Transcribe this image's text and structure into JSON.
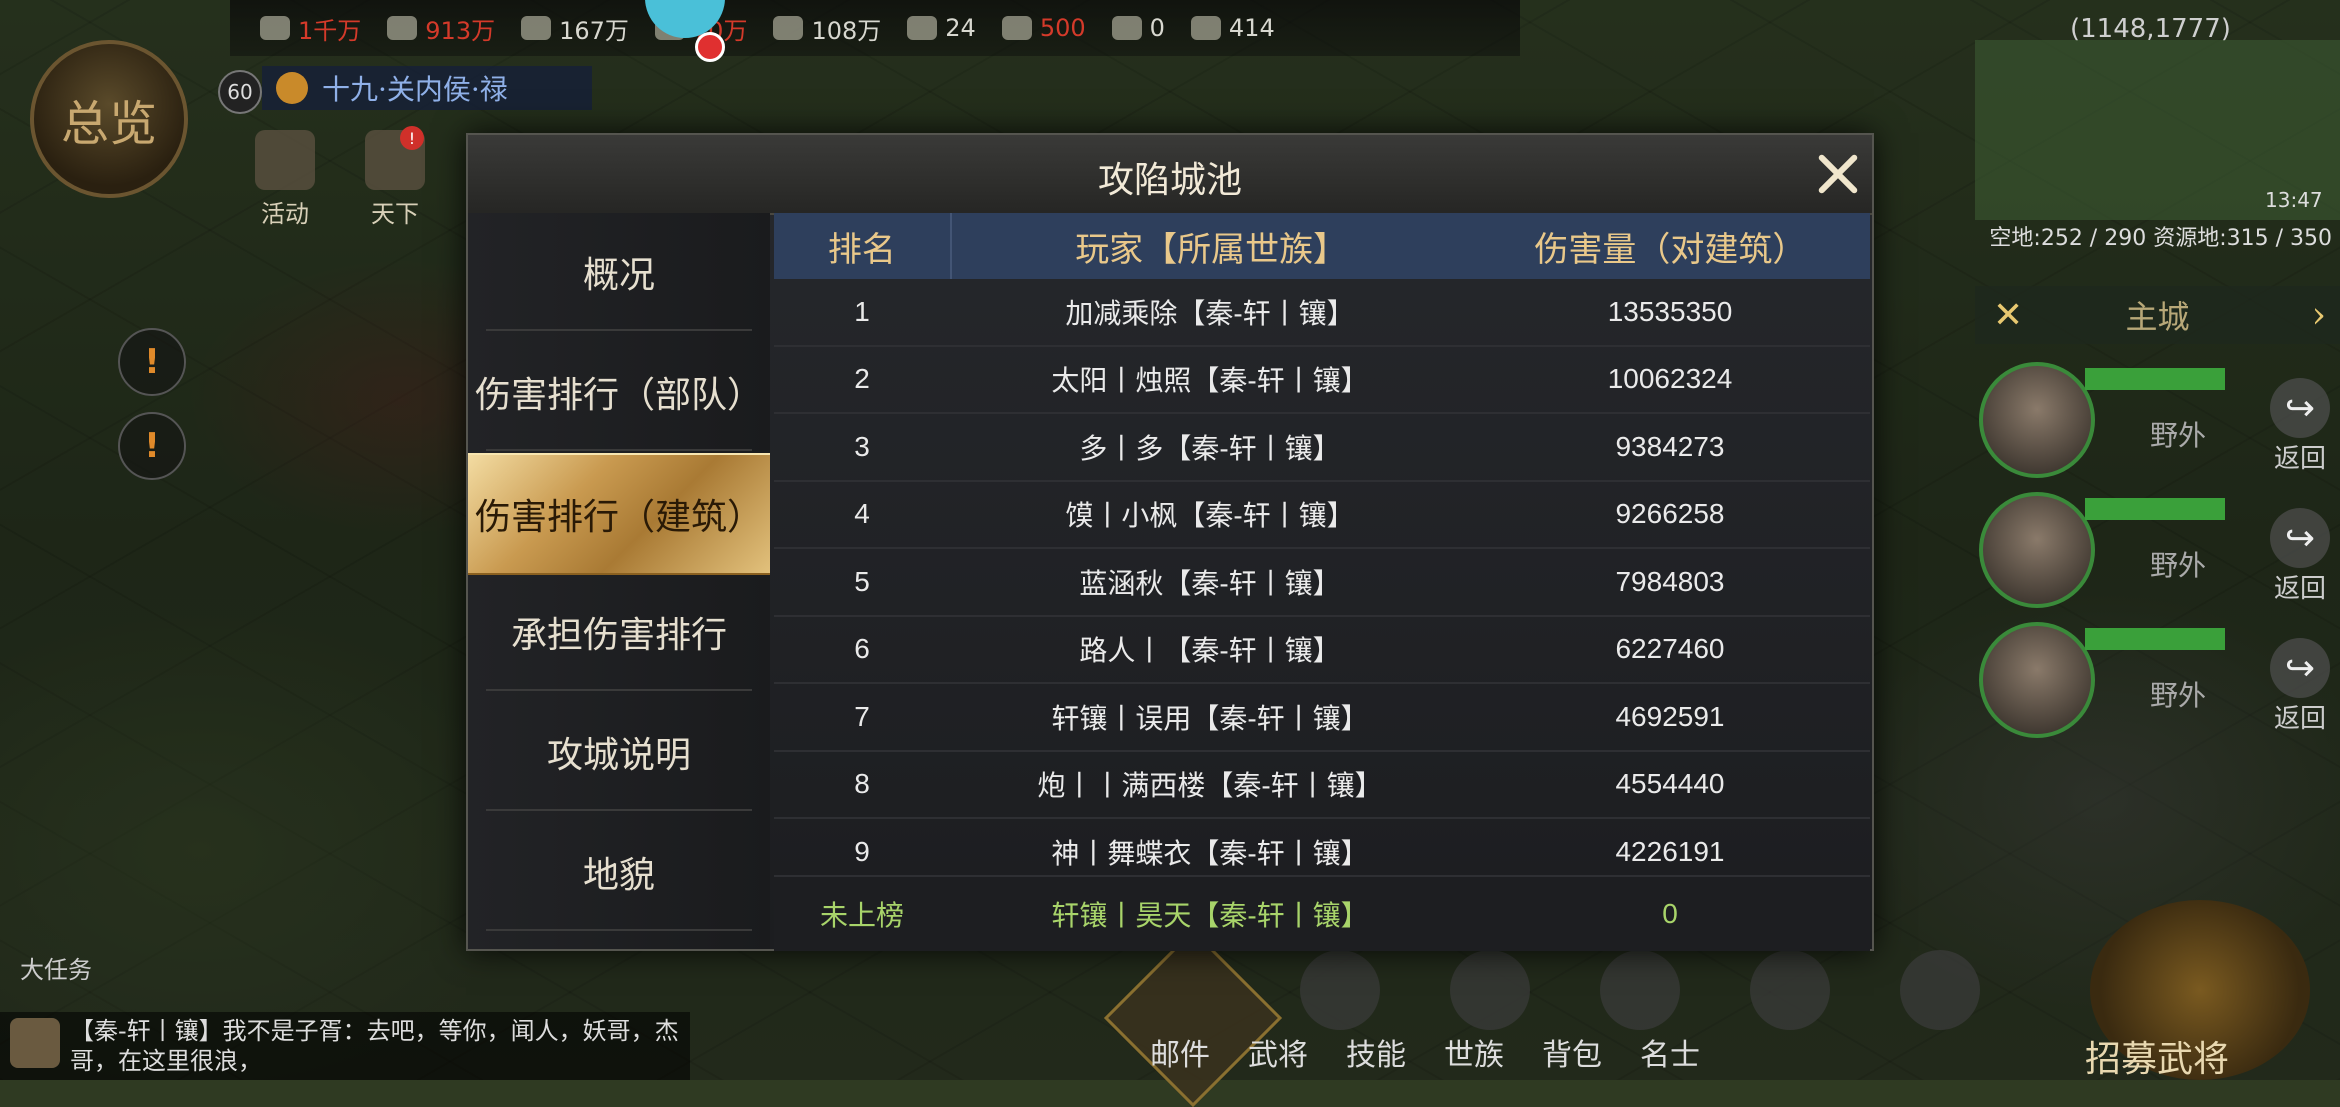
{
  "hud": {
    "coord": "(1148,1777)",
    "overview_label": "总览",
    "player_level": "60",
    "player_title": "十九·关内侯·禄",
    "resources": [
      {
        "icon": "wood-icon",
        "value": "1千万",
        "color": "red"
      },
      {
        "icon": "iron-icon",
        "value": "913万",
        "color": "red"
      },
      {
        "icon": "stone-icon",
        "value": "167万",
        "color": "white"
      },
      {
        "icon": "grain-icon",
        "value": "70万",
        "color": "red"
      },
      {
        "icon": "copper-icon",
        "value": "108万",
        "color": "white"
      },
      {
        "icon": "gold-icon",
        "value": "24",
        "color": "white"
      },
      {
        "icon": "jade-icon",
        "value": "500",
        "color": "red"
      },
      {
        "icon": "token-icon",
        "value": "0",
        "color": "white"
      },
      {
        "icon": "troop-icon",
        "value": "414",
        "color": "white"
      }
    ],
    "top_icons": [
      {
        "label": "活动"
      },
      {
        "label": "天下"
      }
    ],
    "land_info": "空地:252 / 290  资源地:315 / 350",
    "time": "13:47",
    "main_city": "主城",
    "heroes": [
      {
        "location": "野外",
        "return_label": "返回"
      },
      {
        "location": "野外",
        "return_label": "返回"
      },
      {
        "location": "野外",
        "return_label": "返回"
      }
    ],
    "recruit_label": "招募武将",
    "bottom_menu": [
      "邮件",
      "武将",
      "技能",
      "世族",
      "背包",
      "名士"
    ],
    "task_label": "大任务",
    "chat_text": "【秦-轩丨镶】我不是子胥：去吧，等你，闻人，妖哥，杰哥，在这里很浪，"
  },
  "dialog": {
    "title": "攻陷城池",
    "tabs": [
      {
        "label": "概况",
        "active": false
      },
      {
        "label": "伤害排行（部队）",
        "active": false
      },
      {
        "label": "伤害排行（建筑）",
        "active": true
      },
      {
        "label": "承担伤害排行",
        "active": false
      },
      {
        "label": "攻城说明",
        "active": false
      },
      {
        "label": "地貌",
        "active": false
      }
    ],
    "columns": {
      "rank": "排名",
      "player": "玩家【所属世族】",
      "damage": "伤害量（对建筑）"
    },
    "rows": [
      {
        "rank": "1",
        "player": "加减乘除【秦-轩丨镶】",
        "damage": "13535350"
      },
      {
        "rank": "2",
        "player": "太阳丨烛照【秦-轩丨镶】",
        "damage": "10062324"
      },
      {
        "rank": "3",
        "player": "多丨多【秦-轩丨镶】",
        "damage": "9384273"
      },
      {
        "rank": "4",
        "player": "馍丨小枫【秦-轩丨镶】",
        "damage": "9266258"
      },
      {
        "rank": "5",
        "player": "蓝涵秋【秦-轩丨镶】",
        "damage": "7984803"
      },
      {
        "rank": "6",
        "player": "路人丨【秦-轩丨镶】",
        "damage": "6227460"
      },
      {
        "rank": "7",
        "player": "轩镶丨误用【秦-轩丨镶】",
        "damage": "4692591"
      },
      {
        "rank": "8",
        "player": "炮丨丨满西楼【秦-轩丨镶】",
        "damage": "4554440"
      },
      {
        "rank": "9",
        "player": "神丨舞蝶衣【秦-轩丨镶】",
        "damage": "4226191"
      }
    ],
    "self_row": {
      "rank": "未上榜",
      "player": "轩镶丨昊天【秦-轩丨镶】",
      "damage": "0"
    }
  }
}
